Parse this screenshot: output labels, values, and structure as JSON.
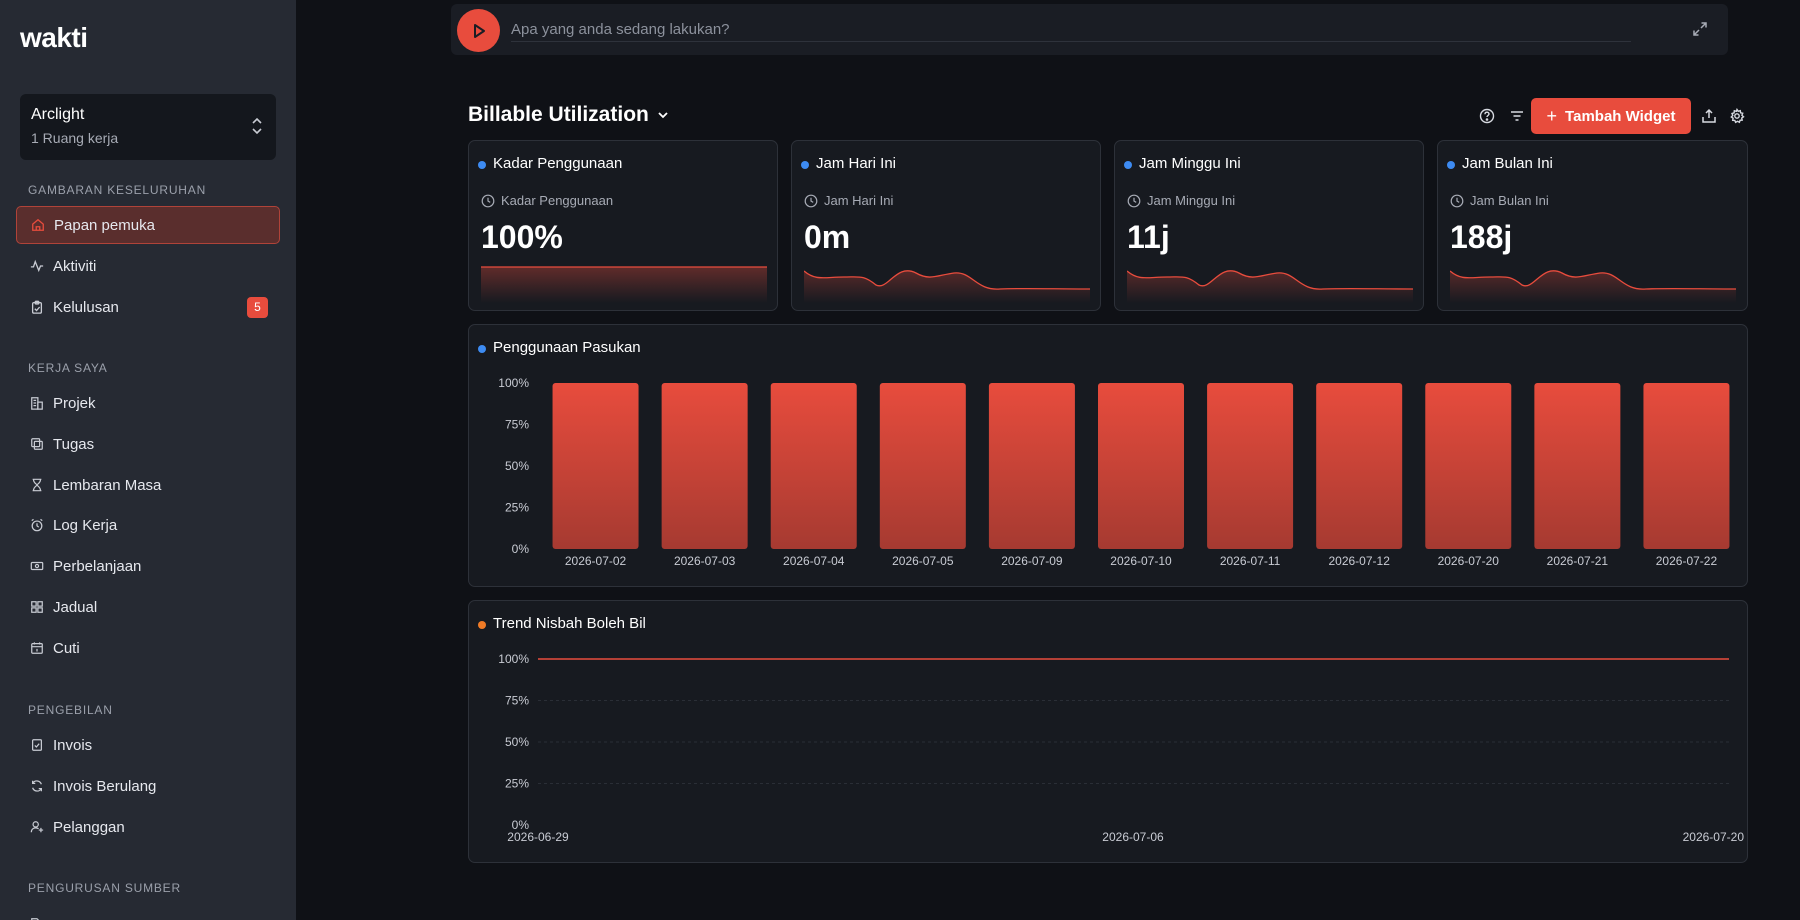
{
  "app": {
    "logo": "wakti"
  },
  "workspace": {
    "name": "Arclight",
    "subtitle": "1 Ruang kerja"
  },
  "sidebar": {
    "sections": [
      {
        "label": "GAMBARAN KESELURUHAN",
        "items": [
          {
            "label": "Papan pemuka",
            "icon": "home-icon",
            "active": true
          },
          {
            "label": "Aktiviti",
            "icon": "activity-icon"
          },
          {
            "label": "Kelulusan",
            "icon": "clipboard-check-icon",
            "badge": "5"
          }
        ]
      },
      {
        "label": "KERJA SAYA",
        "items": [
          {
            "label": "Projek",
            "icon": "building-icon"
          },
          {
            "label": "Tugas",
            "icon": "tasks-icon"
          },
          {
            "label": "Lembaran Masa",
            "icon": "hourglass-icon"
          },
          {
            "label": "Log Kerja",
            "icon": "alarm-clock-icon"
          },
          {
            "label": "Perbelanjaan",
            "icon": "banknote-icon"
          },
          {
            "label": "Jadual",
            "icon": "grid-icon"
          },
          {
            "label": "Cuti",
            "icon": "calendar-icon"
          }
        ]
      },
      {
        "label": "PENGEBILAN",
        "items": [
          {
            "label": "Invois",
            "icon": "invoice-icon"
          },
          {
            "label": "Invois Berulang",
            "icon": "refresh-icon"
          },
          {
            "label": "Pelanggan",
            "icon": "user-plus-icon"
          }
        ]
      },
      {
        "label": "PENGURUSAN SUMBER",
        "items": []
      }
    ]
  },
  "timer": {
    "placeholder": "Apa yang anda sedang lakukan?"
  },
  "dashboard": {
    "title": "Billable Utilization",
    "add_widget_label": "Tambah Widget"
  },
  "stats": [
    {
      "title": "Kadar Penggunaan",
      "subtitle": "Kadar Penggunaan",
      "value": "100%"
    },
    {
      "title": "Jam Hari Ini",
      "subtitle": "Jam Hari Ini",
      "value": "0m"
    },
    {
      "title": "Jam Minggu Ini",
      "subtitle": "Jam Minggu Ini",
      "value": "11j"
    },
    {
      "title": "Jam Bulan Ini",
      "subtitle": "Jam Bulan Ini",
      "value": "188j"
    }
  ],
  "colors": {
    "accent": "#e84c3d",
    "dot_blue": "#3d8bf2",
    "dot_orange": "#f07b26"
  },
  "chart_data": [
    {
      "type": "bar",
      "title": "Penggunaan Pasukan",
      "categories": [
        "2026-07-02",
        "2026-07-03",
        "2026-07-04",
        "2026-07-05",
        "2026-07-09",
        "2026-07-10",
        "2026-07-11",
        "2026-07-12",
        "2026-07-20",
        "2026-07-21",
        "2026-07-22"
      ],
      "values": [
        100,
        100,
        100,
        100,
        100,
        100,
        100,
        100,
        100,
        100,
        100
      ],
      "ylim": [
        0,
        100
      ],
      "yticks": [
        "0%",
        "25%",
        "50%",
        "75%",
        "100%"
      ]
    },
    {
      "type": "line",
      "title": "Trend Nisbah Boleh Bil",
      "x": [
        "2026-06-29",
        "2026-07-06",
        "2026-07-20"
      ],
      "values": [
        100,
        100,
        100
      ],
      "xticks": [
        "2026-06-29",
        "2026-07-06",
        "2026-07-20"
      ],
      "ylim": [
        0,
        100
      ],
      "yticks": [
        "0%",
        "25%",
        "50%",
        "75%",
        "100%"
      ]
    }
  ]
}
